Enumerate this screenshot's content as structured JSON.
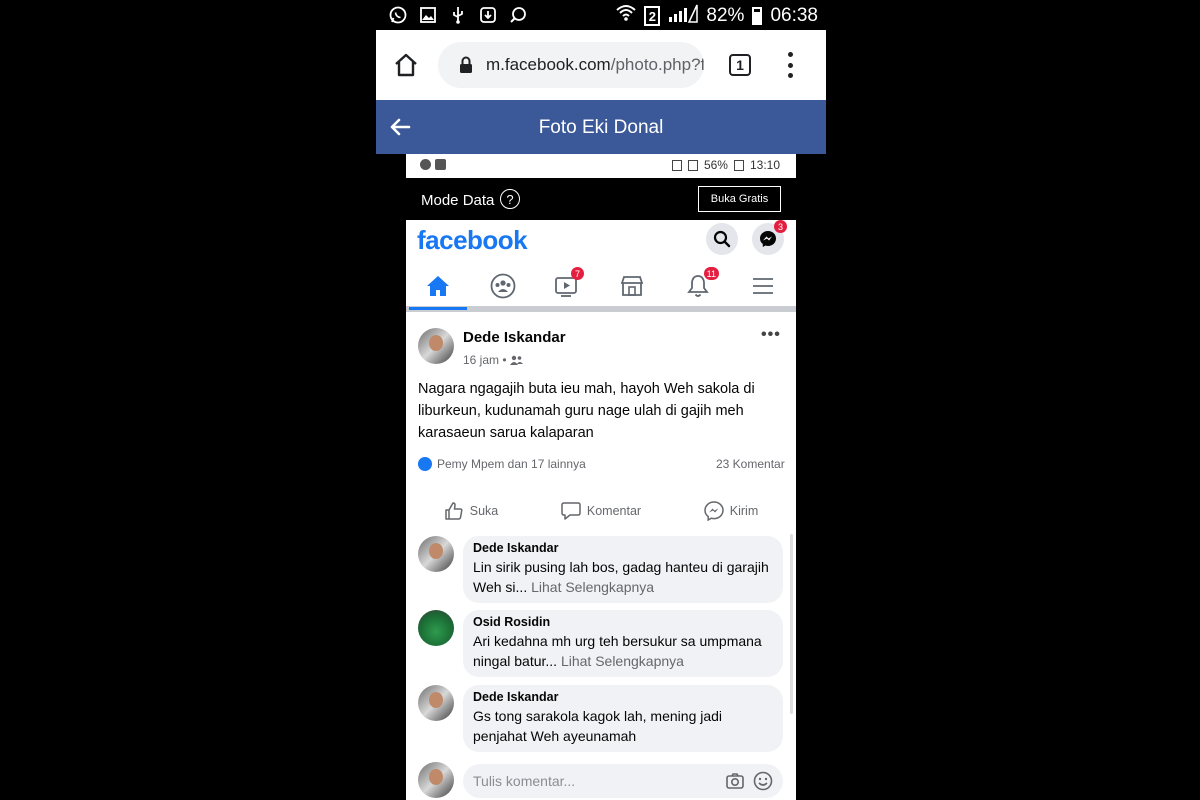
{
  "outer_status": {
    "battery": "82%",
    "time": "06:38",
    "sim_label": "2",
    "icons": [
      "whatsapp-icon",
      "gallery-icon",
      "usb-icon",
      "download-icon",
      "cast-icon",
      "wifi-icon",
      "signal-icon"
    ]
  },
  "browser": {
    "url_host": "m.facebook.com",
    "url_path": "/photo.php?f",
    "tab_count": "1"
  },
  "photo_header": {
    "title": "Foto Eki Donal"
  },
  "inner_status": {
    "battery": "56%",
    "time": "13:10"
  },
  "mode_data": {
    "label": "Mode Data",
    "help": "?",
    "button": "Buka Gratis"
  },
  "fb": {
    "logo": "facebook",
    "messenger_badge": "3",
    "video_badge": "7",
    "notif_badge": "11"
  },
  "post": {
    "author": "Dede Iskandar",
    "time": "16 jam •",
    "text": "Nagara ngagajih buta ieu mah, hayoh Weh sakola di liburkeun, kudunamah guru nage ulah di gajih meh karasaeun sarua kalaparan",
    "reactions": "Pemy Mpem dan 17 lainnya",
    "comment_count": "23 Komentar",
    "actions": {
      "like": "Suka",
      "comment": "Komentar",
      "send": "Kirim"
    }
  },
  "comments": [
    {
      "name": "Dede Iskandar",
      "text": "Lin sirik pusing lah bos, gadag hanteu di garajih Weh si...",
      "see_more": "Lihat Selengkapnya"
    },
    {
      "name": "Osid Rosidin",
      "text": "Ari kedahna mh urg teh bersukur sa umpmana ningal batur...",
      "see_more": "Lihat Selengkapnya"
    },
    {
      "name": "Dede Iskandar",
      "text": "Gs tong sarakola kagok lah, mening jadi penjahat Weh ayeunamah",
      "see_more": ""
    }
  ],
  "write_comment": {
    "placeholder": "Tulis komentar..."
  },
  "colors": {
    "fb_blue": "#1877f2",
    "header_blue": "#3b5998",
    "badge_red": "#e41e3f"
  }
}
